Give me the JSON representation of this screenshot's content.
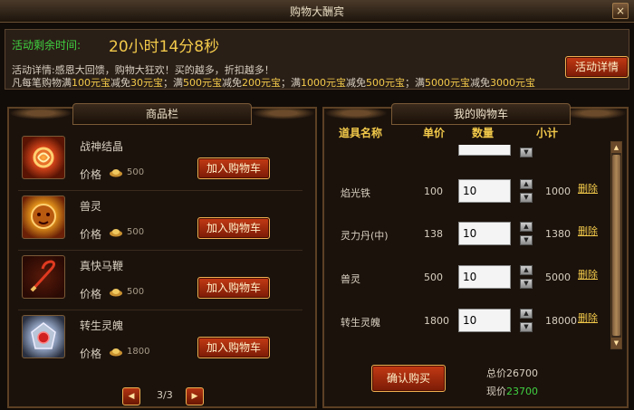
{
  "window": {
    "title": "购物大酬宾",
    "close_glyph": "×"
  },
  "event": {
    "time_label": "活动剩余时间:",
    "time_value": "20小时14分8秒",
    "detail_prefix": "活动详情:",
    "detail_text": "感恩大回馈，购物大狂欢！买的越多，折扣越多！",
    "tiers": [
      {
        "prefix": "凡每笔购物满",
        "spend": "100元宝",
        "mid": "减免",
        "discount": "30元宝",
        "sep": "；满"
      },
      {
        "spend": "500元宝",
        "mid": "减免",
        "discount": "200元宝",
        "sep": "；满"
      },
      {
        "spend": "1000元宝",
        "mid": "减免",
        "discount": "500元宝",
        "sep": "；满"
      },
      {
        "spend": "5000元宝",
        "mid": "减免",
        "discount": "3000元宝",
        "sep": ""
      }
    ],
    "detail_button": "活动详情"
  },
  "goods": {
    "tab_label": "商品栏",
    "price_label": "价格",
    "add_button": "加入购物车",
    "items": [
      {
        "name": "战神结晶",
        "price": "500",
        "icon": "war-crystal-icon",
        "color": "#d8461a"
      },
      {
        "name": "兽灵",
        "price": "500",
        "icon": "beast-spirit-icon",
        "color": "#e0901a"
      },
      {
        "name": "真快马鞭",
        "price": "500",
        "icon": "horse-whip-icon",
        "color": "#c03020"
      },
      {
        "name": "转生灵魄",
        "price": "1800",
        "icon": "rebirth-soul-icon",
        "color": "#8a9ab8"
      }
    ],
    "pager": {
      "text": "3/3",
      "prev": "◀",
      "next": "▶"
    }
  },
  "cart": {
    "tab_label": "我的购物车",
    "columns": {
      "name": "道具名称",
      "price": "单价",
      "qty": "数量",
      "subtotal": "小计"
    },
    "delete_label": "删除",
    "rows": [
      {
        "name": "焰光铁",
        "price": "100",
        "qty": "10",
        "subtotal": "1000"
      },
      {
        "name": "灵力丹(中)",
        "price": "138",
        "qty": "10",
        "subtotal": "1380"
      },
      {
        "name": "兽灵",
        "price": "500",
        "qty": "10",
        "subtotal": "5000"
      },
      {
        "name": "转生灵魄",
        "price": "1800",
        "qty": "10",
        "subtotal": "18000"
      }
    ],
    "confirm_button": "确认购买",
    "total_label": "总价",
    "total_value": "26700",
    "now_label": "现价",
    "now_value": "23700"
  },
  "colors": {
    "gold": "#f2c94a",
    "green": "#40d040",
    "button_red": "#c43a14"
  }
}
